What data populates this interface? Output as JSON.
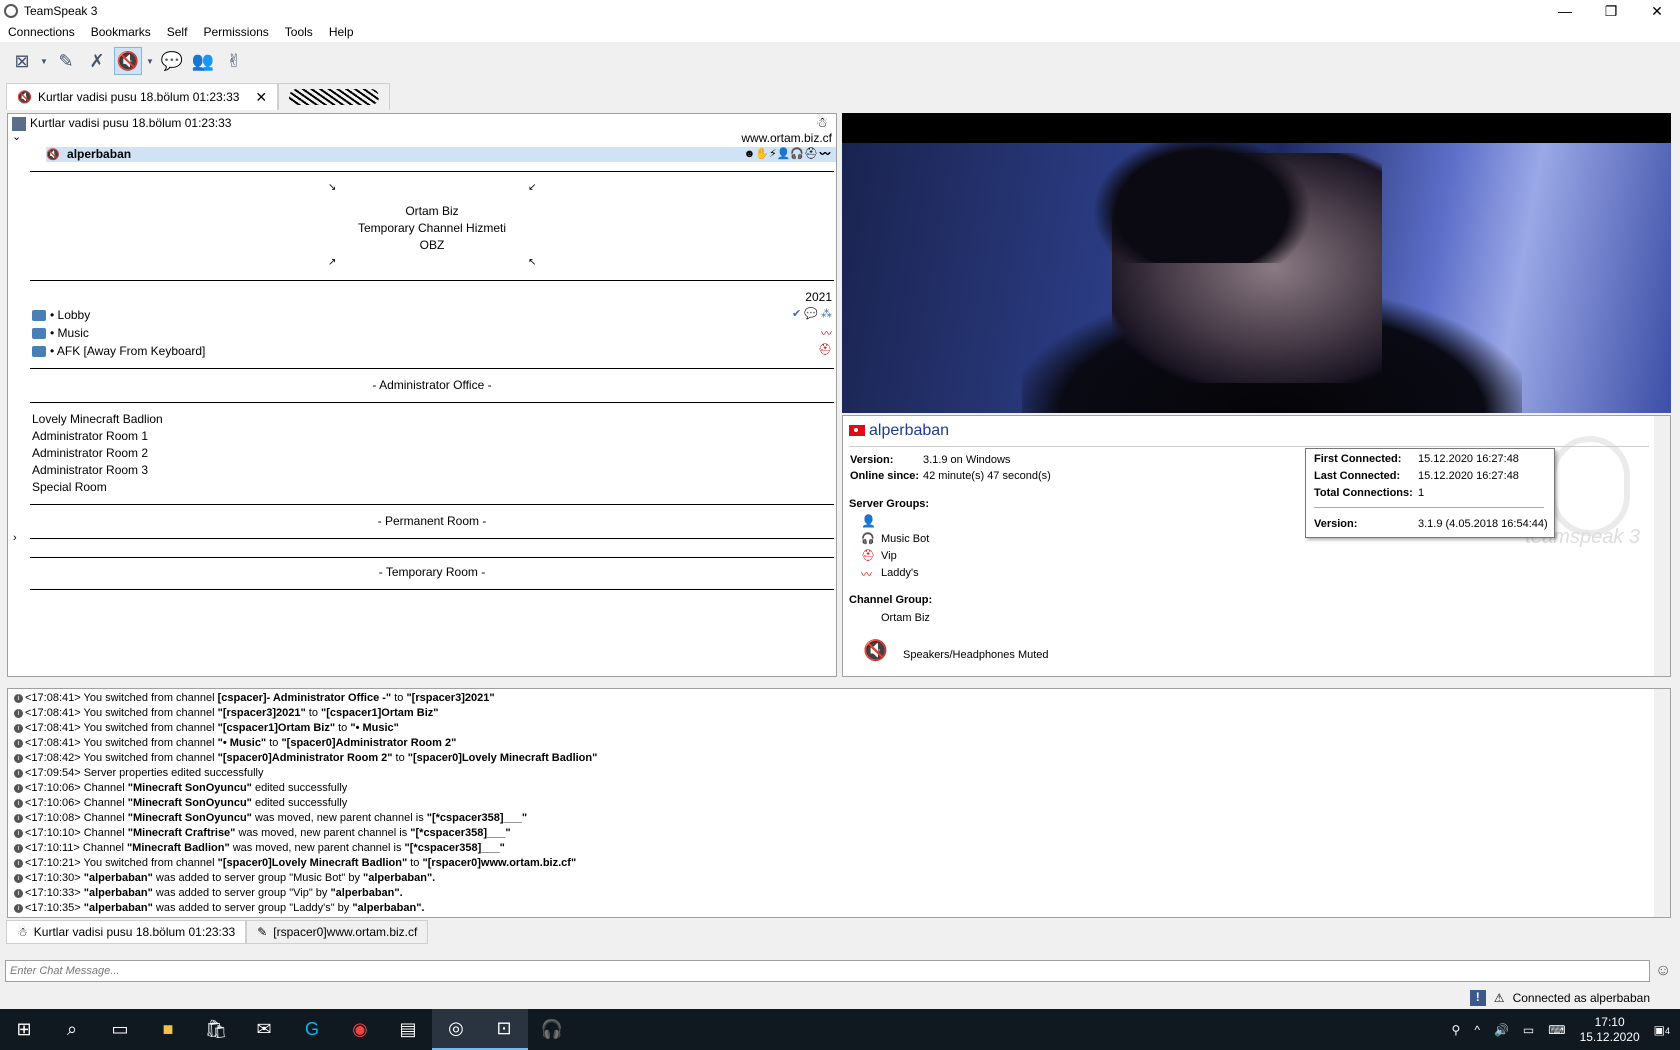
{
  "window": {
    "title": "TeamSpeak 3"
  },
  "menu": [
    "Connections",
    "Bookmarks",
    "Self",
    "Permissions",
    "Tools",
    "Help"
  ],
  "tabs": [
    {
      "label": "Kurtlar vadisi pusu 18.bölum 01:23:33"
    }
  ],
  "tree": {
    "server_name": "Kurtlar vadisi pusu 18.bölum 01:23:33",
    "domain": "www.ortam.biz.cf",
    "user": "alperbaban",
    "banner": [
      "Ortam Biz",
      "Temporary Channel Hizmeti",
      "OBZ"
    ],
    "year": "2021",
    "channels": [
      "• Lobby",
      "• Music",
      "• AFK [Away From Keyboard]"
    ],
    "admin_header": "- Administrator Office -",
    "admin_rooms": [
      "Lovely Minecraft Badlion",
      "Administrator Room 1",
      "Administrator Room 2",
      "Administrator Room 3",
      "Special Room"
    ],
    "permanent_header": "- Permanent Room -",
    "temporary_header": "- Temporary Room -"
  },
  "info": {
    "name": "alperbaban",
    "version_label": "Version:",
    "version": "3.1.9 on Windows",
    "online_label": "Online since:",
    "online": "42 minute(s) 47 second(s)",
    "server_groups_label": "Server Groups:",
    "server_groups": [
      "Music Bot",
      "Vip",
      "Laddy's"
    ],
    "channel_group_label": "Channel Group:",
    "channel_group": "Ortam Biz",
    "muted": "Speakers/Headphones Muted",
    "watermark": "teamspeak 3"
  },
  "tooltip": {
    "first_label": "First Connected:",
    "first": "15.12.2020 16:27:48",
    "last_label": "Last Connected:",
    "last": "15.12.2020 16:27:48",
    "total_label": "Total Connections:",
    "total": "1",
    "version_label": "Version:",
    "version": "3.1.9 (4.05.2018 16:54:44)"
  },
  "log": [
    [
      "<17:08:41> You switched from channel ",
      "[cspacer]- Administrator Office -\"",
      " to ",
      "\"[rspacer3]2021\""
    ],
    [
      "<17:08:41> You switched from channel ",
      "\"[rspacer3]2021\"",
      " to ",
      "\"[cspacer1]Ortam Biz\""
    ],
    [
      "<17:08:41> You switched from channel ",
      "\"[cspacer1]Ortam Biz\"",
      " to ",
      "\"• Music\""
    ],
    [
      "<17:08:41> You switched from channel ",
      "\"• Music\"",
      " to ",
      "\"[spacer0]Administrator Room 2\""
    ],
    [
      "<17:08:42> You switched from channel ",
      "\"[spacer0]Administrator Room 2\"",
      " to ",
      "\"[spacer0]Lovely Minecraft Badlion\""
    ],
    [
      "<17:09:54> Server properties edited successfully",
      "",
      "",
      ""
    ],
    [
      "<17:10:06> Channel ",
      "\"Minecraft SonOyuncu\"",
      " edited successfully",
      ""
    ],
    [
      "<17:10:06> Channel ",
      "\"Minecraft SonOyuncu\"",
      " edited successfully",
      ""
    ],
    [
      "<17:10:08> Channel ",
      "\"Minecraft SonOyuncu\"",
      " was moved, new parent channel is ",
      "\"[*cspacer358]___\""
    ],
    [
      "<17:10:10> Channel ",
      "\"Minecraft Craftrise\"",
      " was moved, new parent channel is ",
      "\"[*cspacer358]___\""
    ],
    [
      "<17:10:11> Channel ",
      "\"Minecraft Badlion\"",
      " was moved, new parent channel is ",
      "\"[*cspacer358]___\""
    ],
    [
      "<17:10:21> You switched from channel ",
      "\"[spacer0]Lovely Minecraft Badlion\"",
      " to ",
      "\"[rspacer0]www.ortam.biz.cf\""
    ],
    [
      "<17:10:30> ",
      "\"alperbaban\"",
      " was added to server group \"Music Bot\" by ",
      "\"alperbaban\"."
    ],
    [
      "<17:10:33> ",
      "\"alperbaban\"",
      " was added to server group \"Vip\" by ",
      "\"alperbaban\"."
    ],
    [
      "<17:10:35> ",
      "\"alperbaban\"",
      " was added to server group \"Laddy's\" by ",
      "\"alperbaban\"."
    ]
  ],
  "chat_tabs": [
    "Kurtlar vadisi pusu 18.bölum 01:23:33",
    "[rspacer0]www.ortam.biz.cf"
  ],
  "chat_placeholder": "Enter Chat Message...",
  "status": "Connected as alperbaban",
  "clock": {
    "time": "17:10",
    "date": "15.12.2020"
  },
  "notifications": "4",
  "colors": {
    "accent": "#cfe3f6",
    "taskbar": "#101820",
    "user_name": "#1f3a93"
  }
}
